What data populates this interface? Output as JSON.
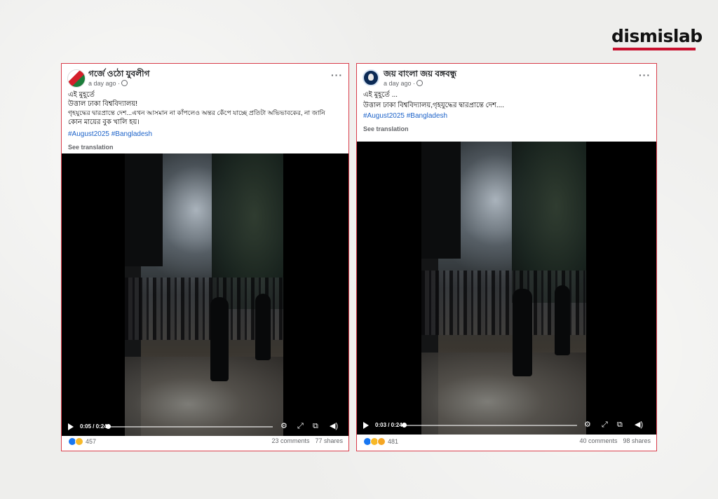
{
  "brand": {
    "name": "dismislab",
    "accent": "#c8102e"
  },
  "posts": [
    {
      "page_name": "গর্জে ওঠো যুবলীগ",
      "time": "a day ago ·",
      "lines": [
        "এই মুহূর্তে",
        "উত্তাল ঢাকা বিশ্ববিদ্যালয়!",
        "গৃহযুদ্ধের দ্বারপ্রান্তে দেশ...এখন আসমান না কাঁপলেও অন্তর কেঁপে যাচ্ছে প্রতিটা অভিভাবকের, না জানি",
        "কোন মায়ের বুক খালি হয়।"
      ],
      "hashtags": "#August2025 #Bangladesh",
      "see_translation": "See translation",
      "video": {
        "time": "0:05 / 0:24",
        "progress": 0.2083
      },
      "reactions_count": "457",
      "comments": "23 comments",
      "shares": "77 shares"
    },
    {
      "page_name": "জয় বাংলা জয় বঙ্গবন্ধু",
      "time": "a day ago ·",
      "lines": [
        "এই মুহূর্তে ...",
        "উত্তাল ঢাকা বিশ্ববিদ্যালয়,গৃহযুদ্ধের দ্বারপ্রান্তে দেশ...."
      ],
      "hashtags": "#August2025 #Bangladesh",
      "see_translation": "See translation",
      "video": {
        "time": "0:03 / 0:24",
        "progress": 0.125
      },
      "reactions_count": "481",
      "comments": "40 comments",
      "shares": "98 shares"
    }
  ],
  "icons": [
    "play-icon",
    "settings-icon",
    "fullscreen-icon",
    "picture-in-picture-icon",
    "volume-icon",
    "more-options-icon",
    "globe-icon"
  ]
}
